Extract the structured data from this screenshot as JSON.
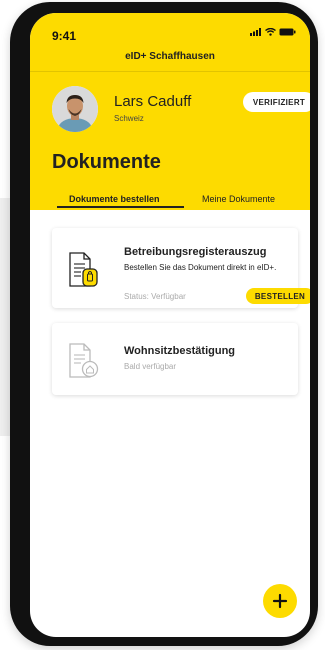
{
  "status_bar": {
    "time": "9:41"
  },
  "header": {
    "app_title": "eID+ Schaffhausen"
  },
  "user": {
    "name": "Lars Caduff",
    "country": "Schweiz",
    "badge": "VERIFIZIERT"
  },
  "page": {
    "title": "Dokumente"
  },
  "tabs": [
    {
      "label": "Dokumente bestellen",
      "active": true
    },
    {
      "label": "Meine Dokumente",
      "active": false
    }
  ],
  "documents": [
    {
      "title": "Betreibungsregisterauszug",
      "description": "Bestellen Sie das Dokument direkt in eID+.",
      "status": "Status: Verfügbar",
      "action": "BESTELLEN"
    },
    {
      "title": "Wohnsitzbestätigung",
      "status": "Bald verfügbar"
    }
  ],
  "colors": {
    "accent": "#fddb00",
    "text": "#222222",
    "muted": "#aaaaaa"
  }
}
